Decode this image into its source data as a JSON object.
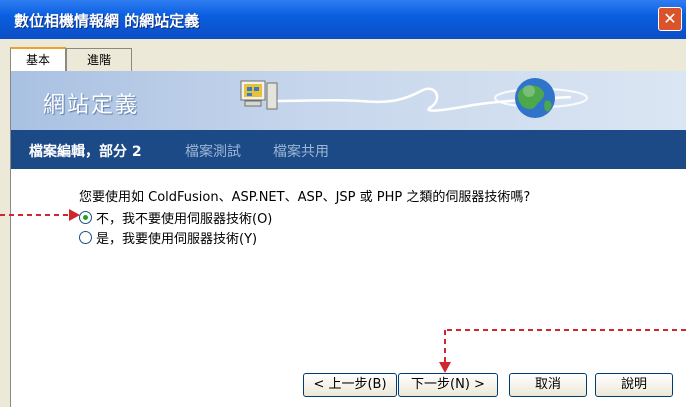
{
  "window": {
    "title": "數位相機情報網 的網站定義",
    "close_glyph": "✕"
  },
  "tabs": [
    {
      "label": "基本",
      "active": true
    },
    {
      "label": "進階",
      "active": false
    }
  ],
  "banner": {
    "title": "網站定義"
  },
  "steps": [
    {
      "label": "檔案編輯，部分 2",
      "active": true
    },
    {
      "label": "檔案測試",
      "active": false
    },
    {
      "label": "檔案共用",
      "active": false
    }
  ],
  "content": {
    "question": "您要使用如 ColdFusion、ASP.NET、ASP、JSP 或 PHP 之類的伺服器技術嗎?",
    "options": [
      {
        "label": "不，我不要使用伺服器技術(O)",
        "checked": true
      },
      {
        "label": "是，我要使用伺服器技術(Y)",
        "checked": false
      }
    ]
  },
  "buttons": {
    "back": "< 上一步(B)",
    "next": "下一步(N) >",
    "cancel": "取消",
    "help": "說明"
  },
  "colors": {
    "title_bar": "#0b4ec6",
    "step_bar": "#1c4a86",
    "annotation_arrow": "#d0262d"
  }
}
